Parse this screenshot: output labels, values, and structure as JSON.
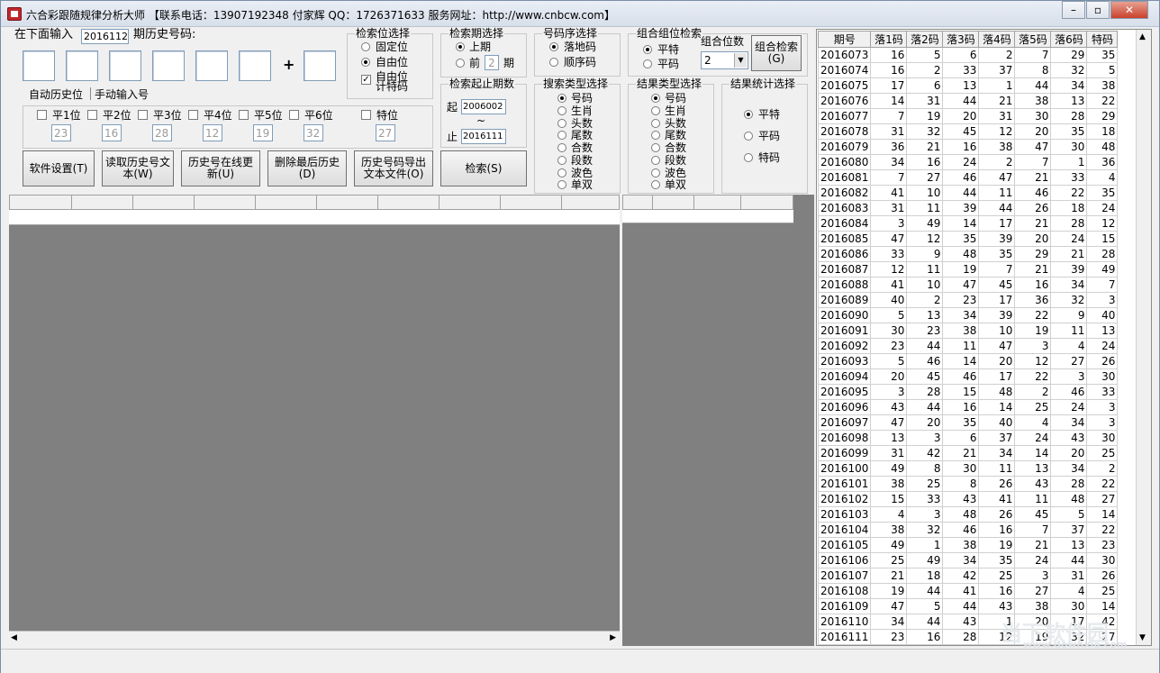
{
  "window": {
    "title": "六合彩跟随规律分析大师 【联系电话：13907192348 付家辉 QQ：1726371633 服务网址：http://www.cnbcw.com】"
  },
  "input_area": {
    "label_before": "在下面输入",
    "period_value": "2016112",
    "label_after": "期历史号码:",
    "plus": "+"
  },
  "tabs": [
    "自动历史位",
    "手动输入号"
  ],
  "positions": {
    "labels": [
      "平1位",
      "平2位",
      "平3位",
      "平4位",
      "平5位",
      "平6位",
      "特位"
    ],
    "values": [
      "23",
      "16",
      "28",
      "12",
      "19",
      "32",
      "27"
    ]
  },
  "buttons": {
    "settings": "软件设置(T)",
    "read_history": "读取历史号文本(W)",
    "online_update": "历史号在线更新(U)",
    "delete_last": "删除最后历史(D)",
    "export": "历史号码导出文本文件(O)",
    "search": "检索(S)",
    "combo_search": "组合检索(G)"
  },
  "search_pos": {
    "title": "检索位选择",
    "options": [
      "固定位",
      "自由位",
      "自由位 计特码"
    ],
    "selected": 1,
    "checkbox_checked": true
  },
  "search_period": {
    "title": "检索期选择",
    "option1": "上期",
    "option2_prefix": "前",
    "option2_value": "2",
    "option2_suffix": "期"
  },
  "number_order": {
    "title": "号码序选择",
    "options": [
      "落地码",
      "顺序码"
    ]
  },
  "combo": {
    "title": "组合组位检索",
    "options": [
      "平特",
      "平码"
    ],
    "count_label": "组合位数",
    "count_value": "2"
  },
  "range": {
    "title": "检索起止期数",
    "start_label": "起",
    "start_value": "2006002",
    "tilde": "~",
    "end_label": "止",
    "end_value": "2016111"
  },
  "search_type": {
    "title": "搜索类型选择",
    "options": [
      "号码",
      "生肖",
      "头数",
      "尾数",
      "合数",
      "段数",
      "波色",
      "单双"
    ]
  },
  "result_type": {
    "title": "结果类型选择",
    "options": [
      "号码",
      "生肖",
      "头数",
      "尾数",
      "合数",
      "段数",
      "波色",
      "单双"
    ]
  },
  "result_stat": {
    "title": "结果统计选择",
    "options": [
      "平特",
      "平码",
      "特码"
    ]
  },
  "history_table": {
    "headers": [
      "期号",
      "落1码",
      "落2码",
      "落3码",
      "落4码",
      "落5码",
      "落6码",
      "特码"
    ],
    "rows": [
      [
        "2016073",
        "16",
        "5",
        "6",
        "2",
        "7",
        "29",
        "35"
      ],
      [
        "2016074",
        "16",
        "2",
        "33",
        "37",
        "8",
        "32",
        "5"
      ],
      [
        "2016075",
        "17",
        "6",
        "13",
        "1",
        "44",
        "34",
        "38"
      ],
      [
        "2016076",
        "14",
        "31",
        "44",
        "21",
        "38",
        "13",
        "22"
      ],
      [
        "2016077",
        "7",
        "19",
        "20",
        "31",
        "30",
        "28",
        "29"
      ],
      [
        "2016078",
        "31",
        "32",
        "45",
        "12",
        "20",
        "35",
        "18"
      ],
      [
        "2016079",
        "36",
        "21",
        "16",
        "38",
        "47",
        "30",
        "48"
      ],
      [
        "2016080",
        "34",
        "16",
        "24",
        "2",
        "7",
        "1",
        "36"
      ],
      [
        "2016081",
        "7",
        "27",
        "46",
        "47",
        "21",
        "33",
        "4"
      ],
      [
        "2016082",
        "41",
        "10",
        "44",
        "11",
        "46",
        "22",
        "35"
      ],
      [
        "2016083",
        "31",
        "11",
        "39",
        "44",
        "26",
        "18",
        "24"
      ],
      [
        "2016084",
        "3",
        "49",
        "14",
        "17",
        "21",
        "28",
        "12"
      ],
      [
        "2016085",
        "47",
        "12",
        "35",
        "39",
        "20",
        "24",
        "15"
      ],
      [
        "2016086",
        "33",
        "9",
        "48",
        "35",
        "29",
        "21",
        "28"
      ],
      [
        "2016087",
        "12",
        "11",
        "19",
        "7",
        "21",
        "39",
        "49"
      ],
      [
        "2016088",
        "41",
        "10",
        "47",
        "45",
        "16",
        "34",
        "7"
      ],
      [
        "2016089",
        "40",
        "2",
        "23",
        "17",
        "36",
        "32",
        "3"
      ],
      [
        "2016090",
        "5",
        "13",
        "34",
        "39",
        "22",
        "9",
        "40"
      ],
      [
        "2016091",
        "30",
        "23",
        "38",
        "10",
        "19",
        "11",
        "13"
      ],
      [
        "2016092",
        "23",
        "44",
        "11",
        "47",
        "3",
        "4",
        "24"
      ],
      [
        "2016093",
        "5",
        "46",
        "14",
        "20",
        "12",
        "27",
        "26"
      ],
      [
        "2016094",
        "20",
        "45",
        "46",
        "17",
        "22",
        "3",
        "30"
      ],
      [
        "2016095",
        "3",
        "28",
        "15",
        "48",
        "2",
        "46",
        "33"
      ],
      [
        "2016096",
        "43",
        "44",
        "16",
        "14",
        "25",
        "24",
        "3"
      ],
      [
        "2016097",
        "47",
        "20",
        "35",
        "40",
        "4",
        "34",
        "3"
      ],
      [
        "2016098",
        "13",
        "3",
        "6",
        "37",
        "24",
        "43",
        "30"
      ],
      [
        "2016099",
        "31",
        "42",
        "21",
        "34",
        "14",
        "20",
        "25"
      ],
      [
        "2016100",
        "49",
        "8",
        "30",
        "11",
        "13",
        "34",
        "2"
      ],
      [
        "2016101",
        "38",
        "25",
        "8",
        "26",
        "43",
        "28",
        "22"
      ],
      [
        "2016102",
        "15",
        "33",
        "43",
        "41",
        "11",
        "48",
        "27"
      ],
      [
        "2016103",
        "4",
        "3",
        "48",
        "26",
        "45",
        "5",
        "14"
      ],
      [
        "2016104",
        "38",
        "32",
        "46",
        "16",
        "7",
        "37",
        "22"
      ],
      [
        "2016105",
        "49",
        "1",
        "38",
        "19",
        "21",
        "13",
        "23"
      ],
      [
        "2016106",
        "25",
        "49",
        "34",
        "35",
        "24",
        "44",
        "30"
      ],
      [
        "2016107",
        "21",
        "18",
        "42",
        "25",
        "3",
        "31",
        "26"
      ],
      [
        "2016108",
        "19",
        "44",
        "41",
        "16",
        "27",
        "4",
        "25"
      ],
      [
        "2016109",
        "47",
        "5",
        "44",
        "43",
        "38",
        "30",
        "14"
      ],
      [
        "2016110",
        "34",
        "44",
        "43",
        "1",
        "20",
        "17",
        "42"
      ],
      [
        "2016111",
        "23",
        "16",
        "28",
        "12",
        "19",
        "32",
        "27"
      ]
    ]
  },
  "watermark": {
    "line1": "当下软件园",
    "line2": "www.downxia.com"
  },
  "icons": {
    "app": "app-icon",
    "minimize": "minimize-icon",
    "maximize": "maximize-icon",
    "close": "close-icon"
  }
}
